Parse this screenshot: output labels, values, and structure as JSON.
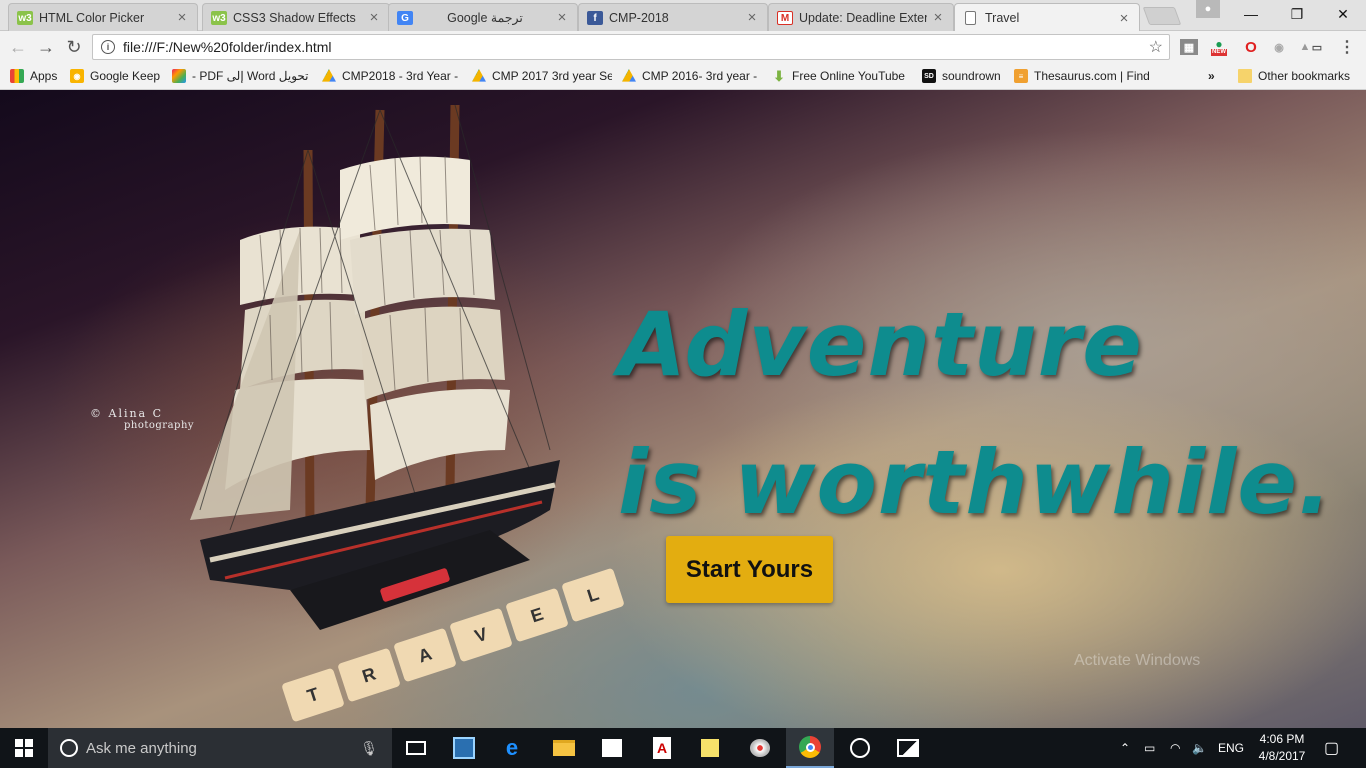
{
  "browser": {
    "tabs": [
      {
        "label": "HTML Color Picker",
        "icon": "w3schools-icon",
        "color": "#8bc34a",
        "active": false
      },
      {
        "label": "CSS3 Shadow Effects",
        "icon": "w3schools-icon",
        "color": "#8bc34a",
        "active": false
      },
      {
        "label": "Google ترجمة",
        "icon": "google-translate-icon",
        "color": "#4285f4",
        "active": false
      },
      {
        "label": "CMP-2018",
        "icon": "facebook-icon",
        "color": "#3b5998",
        "active": false
      },
      {
        "label": "Update: Deadline Extenc",
        "icon": "gmail-icon",
        "color": "#d93025",
        "active": false
      },
      {
        "label": "Travel",
        "icon": "page-icon",
        "color": "#777777",
        "active": true
      }
    ],
    "address": {
      "url": "file:///F:/New%20folder/index.html"
    },
    "bookmarks": [
      {
        "label": "Apps",
        "icon": "apps-grid-icon"
      },
      {
        "label": "Google Keep",
        "icon": "keep-icon"
      },
      {
        "label": "تحويل Word إلى PDF -",
        "icon": "colorful-icon"
      },
      {
        "label": "CMP2018 - 3rd Year -",
        "icon": "drive-icon"
      },
      {
        "label": "CMP 2017 3rd year Se",
        "icon": "drive-icon"
      },
      {
        "label": "CMP 2016- 3rd year -",
        "icon": "drive-icon"
      },
      {
        "label": "Free Online YouTube",
        "icon": "download-icon"
      },
      {
        "label": "soundrown",
        "icon": "sd-icon"
      },
      {
        "label": "Thesaurus.com | Find",
        "icon": "thesaurus-icon"
      }
    ],
    "more_bookmarks": "»",
    "other_bookmarks": "Other bookmarks",
    "extension_badge": "NEW"
  },
  "page": {
    "headline_line1": "Adventure",
    "headline_line2": "is worthwhile.",
    "cta_label": "Start Yours",
    "photo_credit": "© Alina C",
    "photo_credit_sub": "photography",
    "tiles": [
      "T",
      "R",
      "A",
      "V",
      "E",
      "L"
    ],
    "watermark": "Activate Windows"
  },
  "taskbar": {
    "search_placeholder": "Ask me anything",
    "language": "ENG",
    "time": "4:06 PM",
    "date": "4/8/2017"
  },
  "colors": {
    "headline": "#0e8c8e",
    "cta_bg": "#e3ad10",
    "taskbar_bg": "#101418"
  }
}
